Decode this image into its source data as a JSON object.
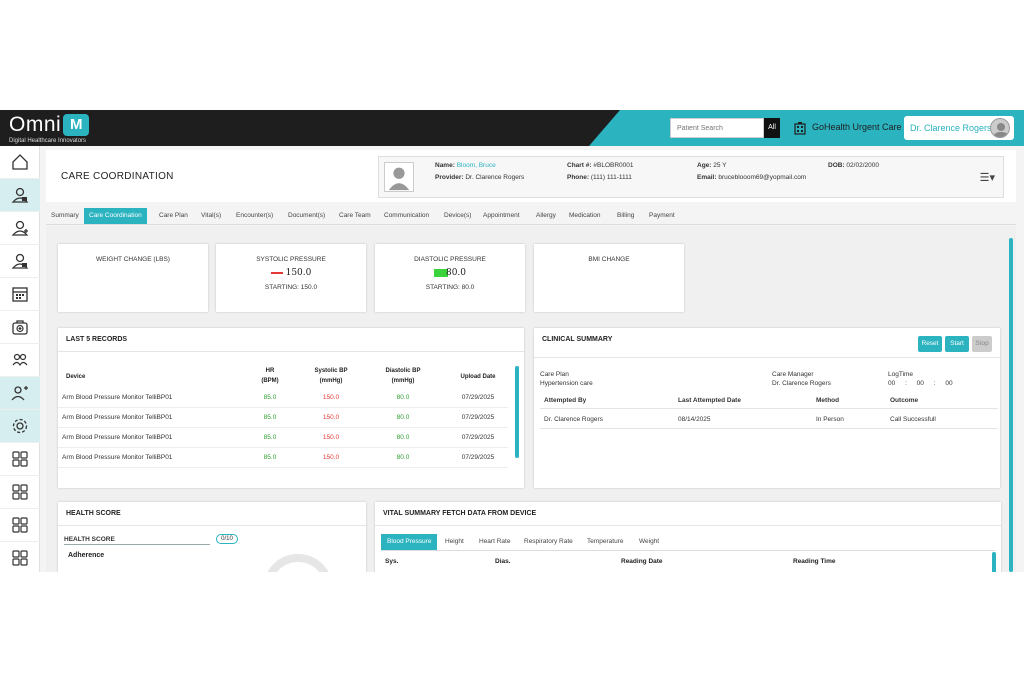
{
  "app": {
    "logo_word": "Omni",
    "logo_mark": "M",
    "tagline": "Digital Healthcare Innovators",
    "search_placeholder": "Patient Search",
    "search_scope": "All",
    "clinic": "GoHealth Urgent Care",
    "user": "Dr. Clarence Rogers"
  },
  "sidebar": {
    "items": [
      {
        "icon": "home-icon",
        "active": false
      },
      {
        "icon": "patient-lock-icon",
        "active": true
      },
      {
        "icon": "patient-add-icon",
        "active": false
      },
      {
        "icon": "patient-lock-icon",
        "active": false
      },
      {
        "icon": "calendar-icon",
        "active": false
      },
      {
        "icon": "medical-kit-icon",
        "active": false
      },
      {
        "icon": "group-icon",
        "active": false
      },
      {
        "icon": "add-user-icon",
        "active": true
      },
      {
        "icon": "settings-icon",
        "active": true
      },
      {
        "icon": "apps-icon",
        "active": false
      },
      {
        "icon": "apps-icon",
        "active": false
      },
      {
        "icon": "apps-icon",
        "active": false
      },
      {
        "icon": "apps-icon",
        "active": false
      }
    ]
  },
  "header": {
    "title": "CARE COORDINATION",
    "name_label": "Name:",
    "name": "Bloom, Bruce",
    "provider_label": "Provider:",
    "provider": "Dr. Clarence Rogers",
    "chart_label": "Chart #:",
    "chart": "#BLOBR0001",
    "phone_label": "Phone:",
    "phone": "(111) 111-1111",
    "age_label": "Age:",
    "age": "25 Y",
    "email_label": "Email:",
    "email": "bruceblooom69@yopmail.com",
    "dob_label": "DOB:",
    "dob": "02/02/2000"
  },
  "tabs": [
    "Summary",
    "Care Coordination",
    "Care Plan",
    "Vital(s)",
    "Encounter(s)",
    "Document(s)",
    "Care Team",
    "Communication",
    "Device(s)",
    "Appointment",
    "Allergy",
    "Medication",
    "Billing",
    "Payment"
  ],
  "active_tab": "Care Coordination",
  "stats": [
    {
      "label": "WEIGHT CHANGE (LBS)",
      "value": "",
      "starting": ""
    },
    {
      "label": "SYSTOLIC PRESSURE",
      "value": "150.0",
      "starting": "STARTING: 150.0",
      "indicator": "#e53935"
    },
    {
      "label": "DIASTOLIC PRESSURE",
      "value": "80.0",
      "starting": "STARTING: 80.0",
      "indicator": "#3bd33b"
    },
    {
      "label": "BMI CHANGE",
      "value": "",
      "starting": ""
    }
  ],
  "records": {
    "title": "LAST 5 RECORDS",
    "headers": {
      "device": "Device",
      "hr": "HR",
      "hr_unit": "(BPM)",
      "sys": "Systolic BP",
      "sys_unit": "(mmHg)",
      "dia": "Diastolic BP",
      "dia_unit": "(mmHg)",
      "date": "Upload Date"
    },
    "rows": [
      {
        "device": "Arm Blood Pressure Monitor TelliBP01",
        "hr": "85.0",
        "sys": "150.0",
        "dia": "80.0",
        "date": "07/29/2025"
      },
      {
        "device": "Arm Blood Pressure Monitor TelliBP01",
        "hr": "85.0",
        "sys": "150.0",
        "dia": "80.0",
        "date": "07/29/2025"
      },
      {
        "device": "Arm Blood Pressure Monitor TelliBP01",
        "hr": "85.0",
        "sys": "150.0",
        "dia": "80.0",
        "date": "07/29/2025"
      },
      {
        "device": "Arm Blood Pressure Monitor TelliBP01",
        "hr": "85.0",
        "sys": "150.0",
        "dia": "80.0",
        "date": "07/29/2025"
      }
    ]
  },
  "clinical": {
    "title": "CLINICAL SUMMARY",
    "reset": "Reset",
    "start": "Start",
    "stop": "Stop",
    "care_plan_label": "Care Plan",
    "care_plan": "Hypertension care",
    "care_manager_label": "Care Manager",
    "care_manager": "Dr. Clarence Rogers",
    "logtime_label": "LogTime",
    "logtime_h": "00",
    "logtime_m": "00",
    "logtime_s": "00",
    "logtime_sep": ":",
    "headers": {
      "by": "Attempted By",
      "date": "Last Attempted Date",
      "method": "Method",
      "outcome": "Outcome"
    },
    "row": {
      "by": "Dr. Clarence Rogers",
      "date": "08/14/2025",
      "method": "In Person",
      "outcome": "Call Successfull"
    }
  },
  "health": {
    "title": "HEALTH SCORE",
    "label": "HEALTH SCORE",
    "score": "0/10",
    "adherence": "Adherence"
  },
  "vital": {
    "title": "VITAL SUMMARY FETCH DATA FROM DEVICE",
    "tabs": [
      "Blood Pressure",
      "Height",
      "Heart Rate",
      "Respiratory Rate",
      "Temperature",
      "Weight"
    ],
    "headers": {
      "sys": "Sys.",
      "dia": "Dias.",
      "date": "Reading Date",
      "time": "Reading Time"
    }
  },
  "colors": {
    "accent": "#2bb3c0",
    "dark": "#1e1e1e",
    "good": "#2e9e2e",
    "bad": "#e53935"
  }
}
